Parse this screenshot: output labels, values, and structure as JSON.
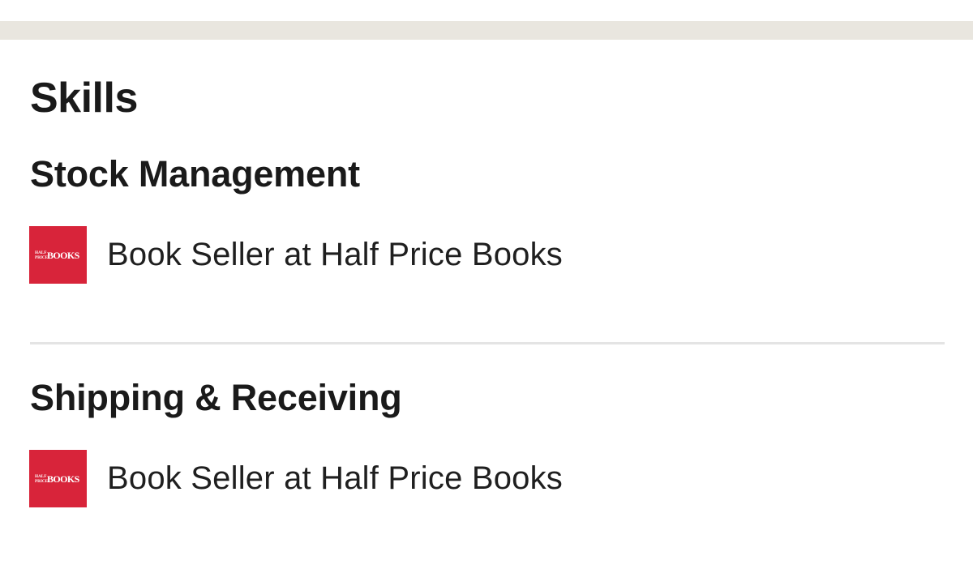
{
  "section": {
    "title": "Skills"
  },
  "skills": [
    {
      "name": "Stock Management",
      "endorsement": {
        "logo_icon": "half-price-books-logo",
        "logo_text_small_top": "HALF",
        "logo_text_small_bottom": "PRICE",
        "logo_text_main": "BOOKS",
        "text": "Book Seller at Half Price Books"
      }
    },
    {
      "name": "Shipping & Receiving",
      "endorsement": {
        "logo_icon": "half-price-books-logo",
        "logo_text_small_top": "HALF",
        "logo_text_small_bottom": "PRICE",
        "logo_text_main": "BOOKS",
        "text": "Book Seller at Half Price Books"
      }
    }
  ],
  "colors": {
    "logo_background": "#d8243a",
    "top_band": "#e9e6df",
    "divider": "#e4e4e4",
    "text": "#1a1a1a"
  }
}
